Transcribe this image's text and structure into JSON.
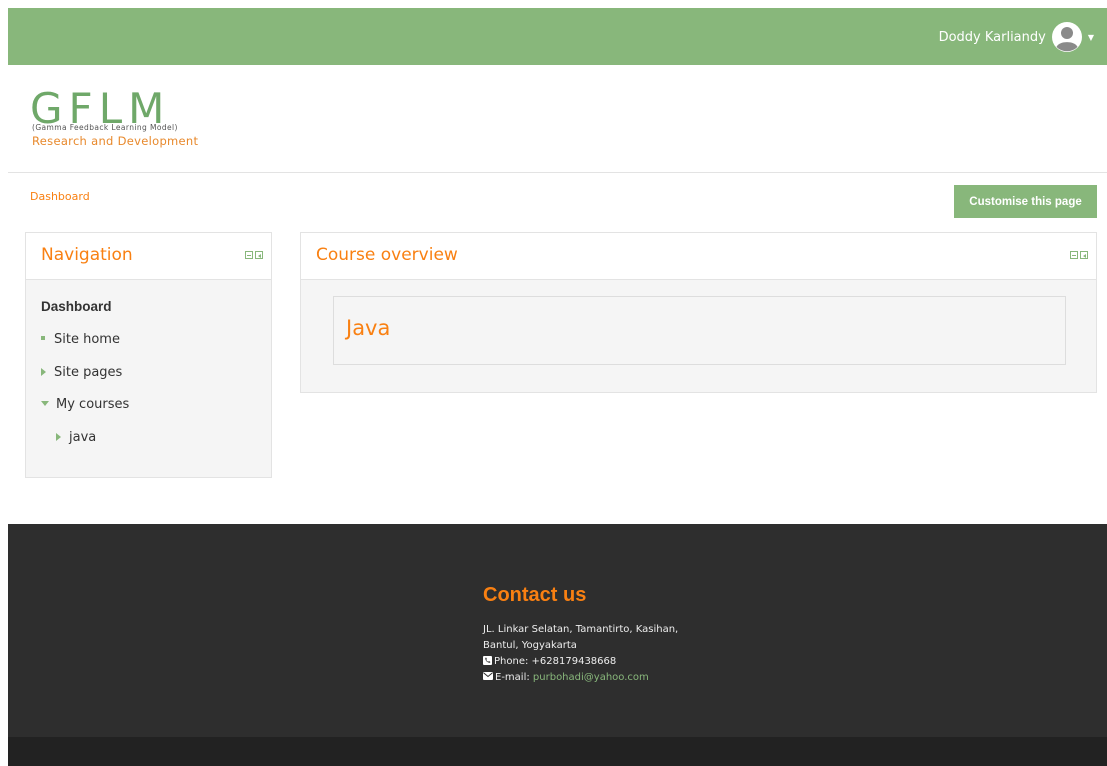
{
  "header": {
    "user_name": "Doddy Karliandy"
  },
  "logo": {
    "big_text": "GFLM",
    "sub_text": "(Gamma Feedback Learning Model)",
    "tagline": "Research and Development"
  },
  "breadcrumb": {
    "item": "Dashboard"
  },
  "actions": {
    "customise_label": "Customise this page"
  },
  "navigation": {
    "title": "Navigation",
    "items": [
      {
        "label": "Dashboard"
      },
      {
        "label": "Site home"
      },
      {
        "label": "Site pages"
      },
      {
        "label": "My courses"
      },
      {
        "label": "java"
      }
    ]
  },
  "course_overview": {
    "title": "Course overview",
    "courses": [
      {
        "name": "Java"
      }
    ]
  },
  "footer": {
    "title": "Contact us",
    "address_line1": "JL. Linkar Selatan, Tamantirto, Kasihan,",
    "address_line2": "Bantul, Yogyakarta",
    "phone": "Phone: +628179438668",
    "email_label": "E-mail:",
    "email": "purbohadi@yahoo.com"
  },
  "colors": {
    "brand_green": "#88b77b",
    "accent_orange": "#f98012",
    "footer_dark": "#2e2e2e"
  },
  "icons": {
    "avatar": "user-avatar-icon",
    "caret": "caret-down-icon",
    "block_hide": "minus-square-icon",
    "block_dock": "dock-left-icon",
    "phone": "phone-icon",
    "email": "envelope-icon"
  }
}
